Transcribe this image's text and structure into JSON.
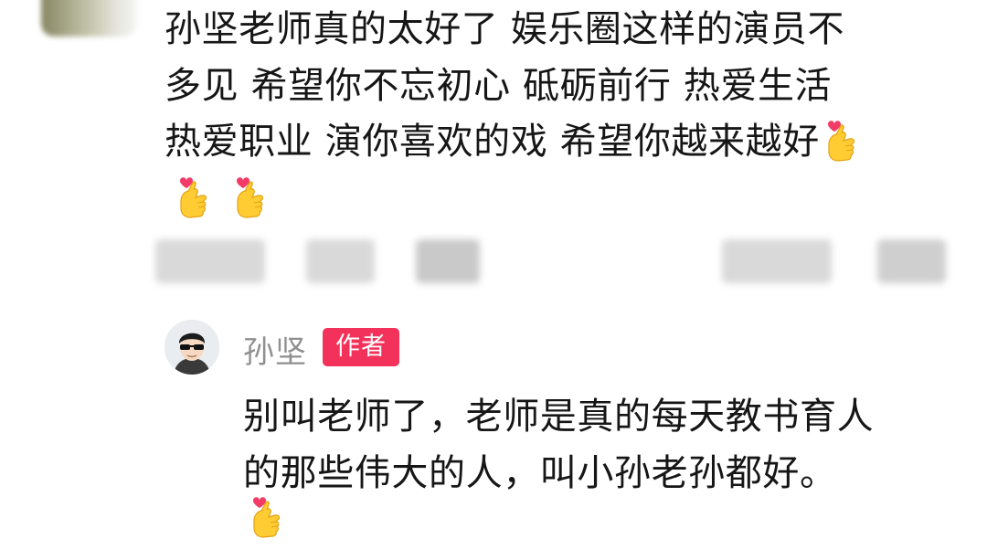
{
  "parent_comment": {
    "lines": [
      "孙坚老师真的太好了 娱乐圈这样的演员不",
      "多见 希望你不忘初心 砥砺前行 热爱生活",
      "热爱职业 演你喜欢的戏 希望你越来越好"
    ],
    "emoji_icon": "heart-hands-icon"
  },
  "reply": {
    "author": "孙坚",
    "author_badge": "作者",
    "lines": [
      "别叫老师了，老师是真的每天教书育人",
      "的那些伟大的人，叫小孙老孙都好。"
    ],
    "emoji_icon": "heart-hands-icon"
  },
  "colors": {
    "badge": "#f2325a",
    "author_text": "#8f8f8f",
    "body_text": "#161616"
  }
}
